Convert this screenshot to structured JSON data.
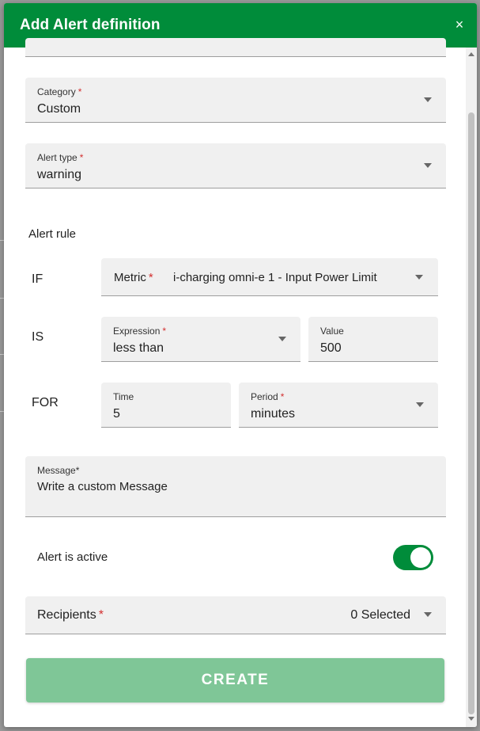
{
  "dialog": {
    "title": "Add Alert definition",
    "close_label": "×"
  },
  "category": {
    "label": "Category",
    "value": "Custom"
  },
  "alert_type": {
    "label": "Alert type",
    "value": "warning"
  },
  "alert_rule": {
    "heading": "Alert rule",
    "if_label": "IF",
    "metric_label": "Metric",
    "metric_value": "i-charging omni-e 1 - Input Power Limit",
    "is_label": "IS",
    "expression_label": "Expression",
    "expression_value": "less than",
    "value_label": "Value",
    "value_value": "500",
    "for_label": "FOR",
    "time_label": "Time",
    "time_value": "5",
    "period_label": "Period",
    "period_value": "minutes"
  },
  "message": {
    "label": "Message*",
    "value": "Write a custom Message"
  },
  "active": {
    "label": "Alert is active",
    "on": true
  },
  "recipients": {
    "label": "Recipients",
    "value": "0 Selected"
  },
  "create_label": "CREATE",
  "required_mark": "*",
  "colors": {
    "header": "#008c3a",
    "button": "#7fc697",
    "required": "#d32f2f"
  }
}
